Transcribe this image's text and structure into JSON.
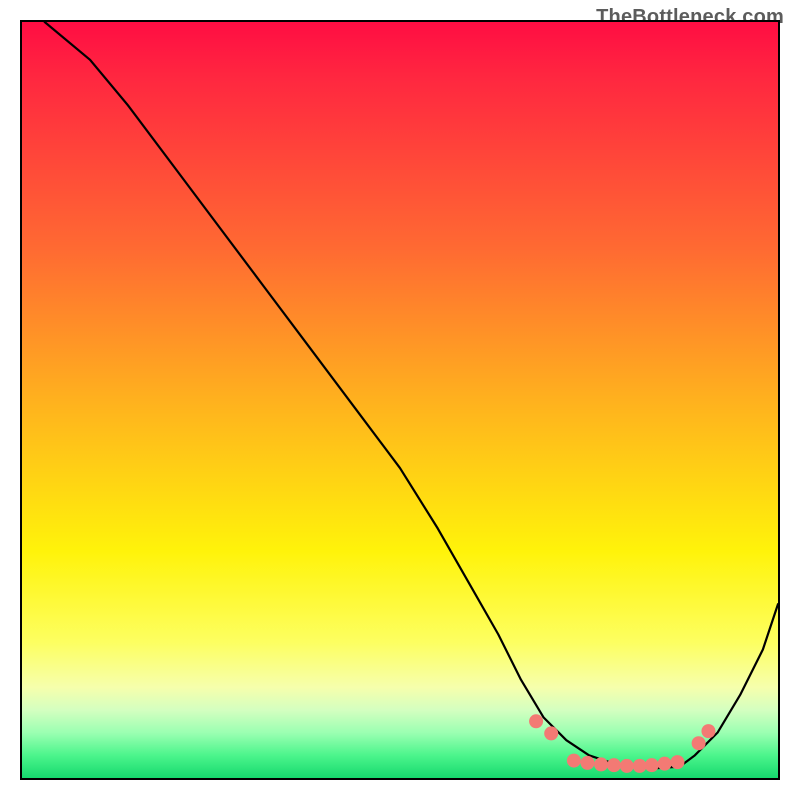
{
  "watermark": "TheBottleneck.com",
  "chart_data": {
    "type": "line",
    "title": "",
    "xlabel": "",
    "ylabel": "",
    "xlim": [
      0,
      100
    ],
    "ylim": [
      0,
      100
    ],
    "grid": false,
    "legend": false,
    "series": [
      {
        "name": "curve",
        "x": [
          3,
          9,
          14,
          20,
          26,
          32,
          38,
          44,
          50,
          55,
          59,
          63,
          66,
          69,
          72,
          75,
          78,
          81,
          84,
          87,
          89,
          92,
          95,
          98,
          100
        ],
        "y": [
          100,
          95,
          89,
          81,
          73,
          65,
          57,
          49,
          41,
          33,
          26,
          19,
          13,
          8,
          5,
          3,
          2,
          1.5,
          1.3,
          1.5,
          3,
          6,
          11,
          17,
          23
        ]
      }
    ],
    "markers": {
      "name": "highlight-dots",
      "color": "#f37a74",
      "radius_px": 7,
      "x": [
        68,
        70,
        73,
        74.8,
        76.6,
        78.3,
        80,
        81.7,
        83.3,
        85,
        86.7,
        89.5,
        90.8
      ],
      "y": [
        7.5,
        5.9,
        2.3,
        2.0,
        1.8,
        1.7,
        1.6,
        1.6,
        1.7,
        1.9,
        2.1,
        4.6,
        6.2
      ]
    },
    "background": {
      "type": "vertical-gradient",
      "stops": [
        {
          "pos": 0.0,
          "color": "#ff0d43"
        },
        {
          "pos": 0.3,
          "color": "#ff6a32"
        },
        {
          "pos": 0.5,
          "color": "#ffb11e"
        },
        {
          "pos": 0.7,
          "color": "#fff30a"
        },
        {
          "pos": 0.88,
          "color": "#f6ffac"
        },
        {
          "pos": 0.97,
          "color": "#4cf58c"
        },
        {
          "pos": 1.0,
          "color": "#16d96e"
        }
      ]
    }
  }
}
